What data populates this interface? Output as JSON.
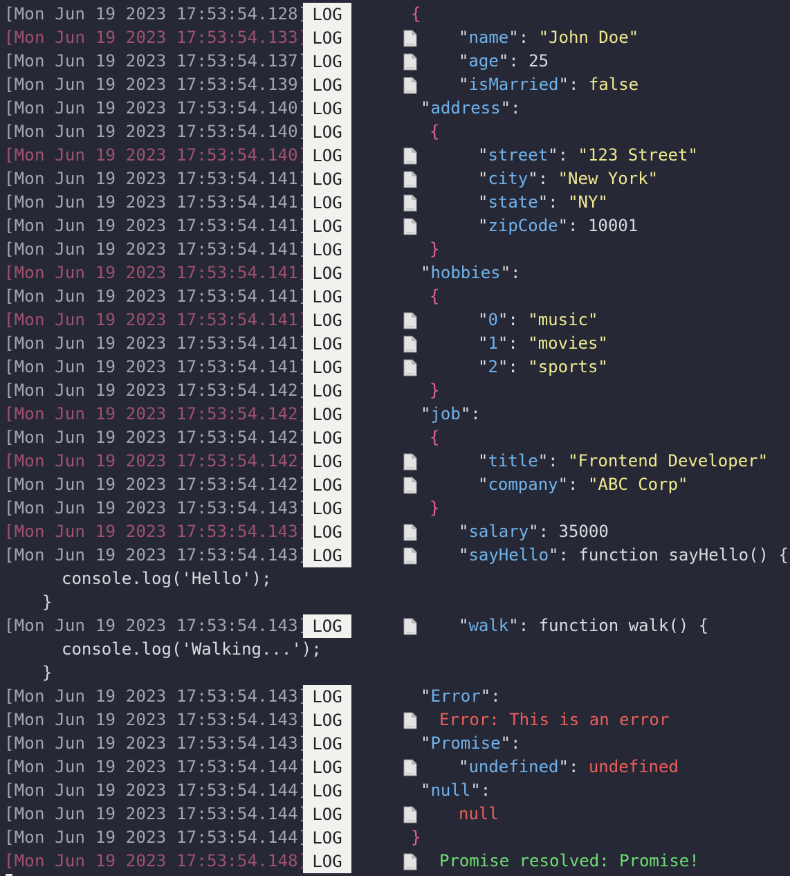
{
  "badge_label": "LOG",
  "colors": {
    "background": "#262935",
    "timestamp": "#a2a6b2",
    "timestamp_alt": "#a0516f",
    "key": "#71b2ec",
    "string": "#f0e991",
    "brace": "#e0609d",
    "error": "#ec5e5a",
    "success": "#6fdc74"
  },
  "lines": [
    {
      "ts": "[Mon Jun 19 2023 17:53:54.128]",
      "alt": false,
      "icon": false,
      "indent": 594,
      "parts": [
        {
          "t": "{",
          "c": "br"
        }
      ]
    },
    {
      "ts": "[Mon Jun 19 2023 17:53:54.133]",
      "alt": true,
      "icon": true,
      "indent": 663,
      "parts": [
        {
          "t": "\"",
          "c": "q"
        },
        {
          "t": "name",
          "c": "k"
        },
        {
          "t": "\": ",
          "c": "q"
        },
        {
          "t": "\"John Doe\"",
          "c": "s"
        }
      ]
    },
    {
      "ts": "[Mon Jun 19 2023 17:53:54.137]",
      "alt": false,
      "icon": true,
      "indent": 663,
      "parts": [
        {
          "t": "\"",
          "c": "q"
        },
        {
          "t": "age",
          "c": "k"
        },
        {
          "t": "\": ",
          "c": "q"
        },
        {
          "t": "25",
          "c": "n"
        }
      ]
    },
    {
      "ts": "[Mon Jun 19 2023 17:53:54.139]",
      "alt": false,
      "icon": true,
      "indent": 663,
      "parts": [
        {
          "t": "\"",
          "c": "q"
        },
        {
          "t": "isMarried",
          "c": "k"
        },
        {
          "t": "\": ",
          "c": "q"
        },
        {
          "t": "false",
          "c": "b"
        }
      ]
    },
    {
      "ts": "[Mon Jun 19 2023 17:53:54.140]",
      "alt": false,
      "icon": false,
      "indent": 608,
      "parts": [
        {
          "t": "\"",
          "c": "q"
        },
        {
          "t": "address",
          "c": "k"
        },
        {
          "t": "\":",
          "c": "q"
        }
      ]
    },
    {
      "ts": "[Mon Jun 19 2023 17:53:54.140]",
      "alt": false,
      "icon": false,
      "indent": 621,
      "parts": [
        {
          "t": "{",
          "c": "br"
        }
      ]
    },
    {
      "ts": "[Mon Jun 19 2023 17:53:54.140]",
      "alt": true,
      "icon": true,
      "indent": 691,
      "parts": [
        {
          "t": "\"",
          "c": "q"
        },
        {
          "t": "street",
          "c": "k"
        },
        {
          "t": "\": ",
          "c": "q"
        },
        {
          "t": "\"123 Street\"",
          "c": "s"
        }
      ]
    },
    {
      "ts": "[Mon Jun 19 2023 17:53:54.141]",
      "alt": false,
      "icon": true,
      "indent": 691,
      "parts": [
        {
          "t": "\"",
          "c": "q"
        },
        {
          "t": "city",
          "c": "k"
        },
        {
          "t": "\": ",
          "c": "q"
        },
        {
          "t": "\"New York\"",
          "c": "s"
        }
      ]
    },
    {
      "ts": "[Mon Jun 19 2023 17:53:54.141]",
      "alt": false,
      "icon": true,
      "indent": 691,
      "parts": [
        {
          "t": "\"",
          "c": "q"
        },
        {
          "t": "state",
          "c": "k"
        },
        {
          "t": "\": ",
          "c": "q"
        },
        {
          "t": "\"NY\"",
          "c": "s"
        }
      ]
    },
    {
      "ts": "[Mon Jun 19 2023 17:53:54.141]",
      "alt": false,
      "icon": true,
      "indent": 691,
      "parts": [
        {
          "t": "\"",
          "c": "q"
        },
        {
          "t": "zipCode",
          "c": "k"
        },
        {
          "t": "\": ",
          "c": "q"
        },
        {
          "t": "10001",
          "c": "n"
        }
      ]
    },
    {
      "ts": "[Mon Jun 19 2023 17:53:54.141]",
      "alt": false,
      "icon": false,
      "indent": 621,
      "parts": [
        {
          "t": "}",
          "c": "br"
        }
      ]
    },
    {
      "ts": "[Mon Jun 19 2023 17:53:54.141]",
      "alt": true,
      "icon": false,
      "indent": 608,
      "parts": [
        {
          "t": "\"",
          "c": "q"
        },
        {
          "t": "hobbies",
          "c": "k"
        },
        {
          "t": "\":",
          "c": "q"
        }
      ]
    },
    {
      "ts": "[Mon Jun 19 2023 17:53:54.141]",
      "alt": false,
      "icon": false,
      "indent": 621,
      "parts": [
        {
          "t": "{",
          "c": "br"
        }
      ]
    },
    {
      "ts": "[Mon Jun 19 2023 17:53:54.141]",
      "alt": true,
      "icon": true,
      "indent": 691,
      "parts": [
        {
          "t": "\"",
          "c": "q"
        },
        {
          "t": "0",
          "c": "k"
        },
        {
          "t": "\": ",
          "c": "q"
        },
        {
          "t": "\"music\"",
          "c": "s"
        }
      ]
    },
    {
      "ts": "[Mon Jun 19 2023 17:53:54.141]",
      "alt": false,
      "icon": true,
      "indent": 691,
      "parts": [
        {
          "t": "\"",
          "c": "q"
        },
        {
          "t": "1",
          "c": "k"
        },
        {
          "t": "\": ",
          "c": "q"
        },
        {
          "t": "\"movies\"",
          "c": "s"
        }
      ]
    },
    {
      "ts": "[Mon Jun 19 2023 17:53:54.141]",
      "alt": false,
      "icon": true,
      "indent": 691,
      "parts": [
        {
          "t": "\"",
          "c": "q"
        },
        {
          "t": "2",
          "c": "k"
        },
        {
          "t": "\": ",
          "c": "q"
        },
        {
          "t": "\"sports\"",
          "c": "s"
        }
      ]
    },
    {
      "ts": "[Mon Jun 19 2023 17:53:54.142]",
      "alt": false,
      "icon": false,
      "indent": 621,
      "parts": [
        {
          "t": "}",
          "c": "br"
        }
      ]
    },
    {
      "ts": "[Mon Jun 19 2023 17:53:54.142]",
      "alt": true,
      "icon": false,
      "indent": 608,
      "parts": [
        {
          "t": "\"",
          "c": "q"
        },
        {
          "t": "job",
          "c": "k"
        },
        {
          "t": "\":",
          "c": "q"
        }
      ]
    },
    {
      "ts": "[Mon Jun 19 2023 17:53:54.142]",
      "alt": false,
      "icon": false,
      "indent": 621,
      "parts": [
        {
          "t": "{",
          "c": "br"
        }
      ]
    },
    {
      "ts": "[Mon Jun 19 2023 17:53:54.142]",
      "alt": true,
      "icon": true,
      "indent": 691,
      "parts": [
        {
          "t": "\"",
          "c": "q"
        },
        {
          "t": "title",
          "c": "k"
        },
        {
          "t": "\": ",
          "c": "q"
        },
        {
          "t": "\"Frontend Developer\"",
          "c": "s"
        }
      ]
    },
    {
      "ts": "[Mon Jun 19 2023 17:53:54.142]",
      "alt": false,
      "icon": true,
      "indent": 691,
      "parts": [
        {
          "t": "\"",
          "c": "q"
        },
        {
          "t": "company",
          "c": "k"
        },
        {
          "t": "\": ",
          "c": "q"
        },
        {
          "t": "\"ABC Corp\"",
          "c": "s"
        }
      ]
    },
    {
      "ts": "[Mon Jun 19 2023 17:53:54.143]",
      "alt": false,
      "icon": false,
      "indent": 621,
      "parts": [
        {
          "t": "}",
          "c": "br"
        }
      ]
    },
    {
      "ts": "[Mon Jun 19 2023 17:53:54.143]",
      "alt": true,
      "icon": true,
      "indent": 663,
      "parts": [
        {
          "t": "\"",
          "c": "q"
        },
        {
          "t": "salary",
          "c": "k"
        },
        {
          "t": "\": ",
          "c": "q"
        },
        {
          "t": "35000",
          "c": "n"
        }
      ]
    },
    {
      "ts": "[Mon Jun 19 2023 17:53:54.143]",
      "alt": false,
      "icon": true,
      "indent": 663,
      "parts": [
        {
          "t": "\"",
          "c": "q"
        },
        {
          "t": "sayHello",
          "c": "k"
        },
        {
          "t": "\": function sayHello() {",
          "c": "q"
        }
      ],
      "continuation": [
        {
          "indent": 89,
          "text": "console.log('Hello');"
        },
        {
          "indent": 61,
          "text": "}"
        }
      ]
    },
    {
      "ts": "[Mon Jun 19 2023 17:53:54.143]",
      "alt": false,
      "icon": true,
      "indent": 663,
      "parts": [
        {
          "t": "\"",
          "c": "q"
        },
        {
          "t": "walk",
          "c": "k"
        },
        {
          "t": "\": function walk() {",
          "c": "q"
        }
      ],
      "continuation": [
        {
          "indent": 89,
          "text": "console.log('Walking...');"
        },
        {
          "indent": 61,
          "text": "}"
        }
      ]
    },
    {
      "ts": "[Mon Jun 19 2023 17:53:54.143]",
      "alt": false,
      "icon": false,
      "indent": 608,
      "parts": [
        {
          "t": "\"",
          "c": "q"
        },
        {
          "t": "Error",
          "c": "k"
        },
        {
          "t": "\":",
          "c": "q"
        }
      ]
    },
    {
      "ts": "[Mon Jun 19 2023 17:53:54.143]",
      "alt": false,
      "icon": true,
      "indent": 635,
      "parts": [
        {
          "t": "Error: This is an error",
          "c": "err"
        }
      ]
    },
    {
      "ts": "[Mon Jun 19 2023 17:53:54.143]",
      "alt": false,
      "icon": false,
      "indent": 608,
      "parts": [
        {
          "t": "\"",
          "c": "q"
        },
        {
          "t": "Promise",
          "c": "k"
        },
        {
          "t": "\":",
          "c": "q"
        }
      ]
    },
    {
      "ts": "[Mon Jun 19 2023 17:53:54.144]",
      "alt": false,
      "icon": true,
      "indent": 663,
      "parts": [
        {
          "t": "\"",
          "c": "q"
        },
        {
          "t": "undefined",
          "c": "k"
        },
        {
          "t": "\": ",
          "c": "q"
        },
        {
          "t": "undefined",
          "c": "err"
        }
      ]
    },
    {
      "ts": "[Mon Jun 19 2023 17:53:54.144]",
      "alt": false,
      "icon": false,
      "indent": 608,
      "parts": [
        {
          "t": "\"",
          "c": "q"
        },
        {
          "t": "null",
          "c": "k"
        },
        {
          "t": "\":",
          "c": "q"
        }
      ]
    },
    {
      "ts": "[Mon Jun 19 2023 17:53:54.144]",
      "alt": false,
      "icon": true,
      "indent": 663,
      "parts": [
        {
          "t": "null",
          "c": "err"
        }
      ]
    },
    {
      "ts": "[Mon Jun 19 2023 17:53:54.144]",
      "alt": false,
      "icon": false,
      "indent": 594,
      "parts": [
        {
          "t": "}",
          "c": "br"
        }
      ]
    },
    {
      "ts": "[Mon Jun 19 2023 17:53:54.148]",
      "alt": true,
      "icon": true,
      "indent": 635,
      "parts": [
        {
          "t": "Promise resolved: Promise!",
          "c": "ok"
        }
      ]
    }
  ]
}
